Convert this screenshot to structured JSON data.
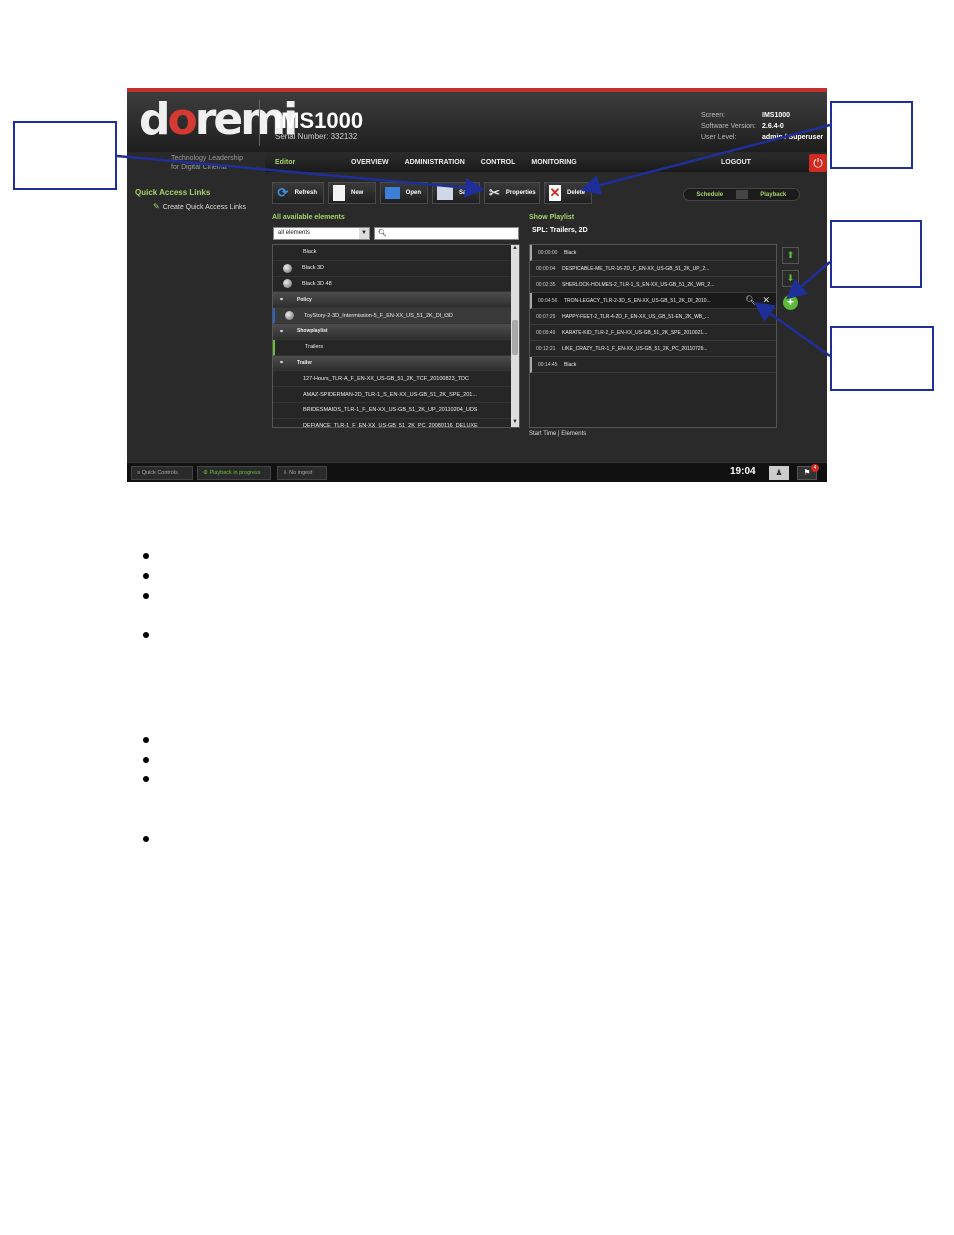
{
  "header": {
    "logo_text": "doremi",
    "tagline": "Technology Leadership for Digital Cinema",
    "product": "IMS1000",
    "serial": "Serial Number: 332132",
    "info": [
      {
        "key": "Screen:",
        "value": "IMS1000"
      },
      {
        "key": "Software Version:",
        "value": "2.6.4-0"
      },
      {
        "key": "User Level:",
        "value": "admin / Superuser"
      }
    ]
  },
  "nav": {
    "editor": "Editor",
    "overview": "OVERVIEW",
    "administration": "ADMINISTRATION",
    "control": "CONTROL",
    "monitoring": "MONITORING",
    "logout": "LOGOUT",
    "power_icon": "power-icon"
  },
  "sidebar": {
    "title": "Quick Access Links",
    "link": "Create Quick Access Links"
  },
  "toolbar": {
    "refresh": "Refresh",
    "new": "New",
    "open": "Open",
    "save": "Save",
    "properties": "Properties",
    "delete": "Delete"
  },
  "mode": {
    "schedule": "Schedule",
    "playback": "Playback"
  },
  "available": {
    "title": "All available elements",
    "filter": "all elements",
    "rows": [
      {
        "text": "Black",
        "kind": "plain"
      },
      {
        "text": "Black 3D",
        "kind": "item"
      },
      {
        "text": "Black 3D 48",
        "kind": "item"
      },
      {
        "text": "Policy",
        "kind": "group"
      },
      {
        "text": "ToyStory-2-3D_Intermission-5_F_EN-XX_US_51_2K_DI_t3D",
        "kind": "selected"
      },
      {
        "text": "Showplaylist",
        "kind": "group"
      },
      {
        "text": "Trailers",
        "kind": "green"
      },
      {
        "text": "Trailer",
        "kind": "group"
      },
      {
        "text": "127-Hours_TLR-A_F_EN-XX_US-GB_51_2K_TCF_20100823_TDC",
        "kind": "plain"
      },
      {
        "text": "AMAZ-SPIDERMAN-2D_TLR-1_S_EN-XX_US-GB_51_2K_SPE_201...",
        "kind": "plain"
      },
      {
        "text": "BRIDESMAIDS_TLR-1_F_EN-XX_US-GB_51_2K_UP_20110204_UDS",
        "kind": "plain"
      },
      {
        "text": "DEFIANCE_TLR-1_F_EN-XX_US-GB_51_2K_PC_20080116_DELUXE",
        "kind": "plain"
      }
    ]
  },
  "playlist": {
    "title": "Show Playlist",
    "spl_name": "SPL: Trailers, 2D",
    "rows": [
      {
        "time": "00:00:00",
        "name": "Black",
        "marked": true
      },
      {
        "time": "00:00:04",
        "name": "DESPICABLE-ME_TLR-16-2D_F_EN-XX_US-GB_51_2K_UP_2...",
        "marked": false
      },
      {
        "time": "00:02:35",
        "name": "SHERLOCK-HOLMES-2_TLR-1_S_EN-XX_US-GB_51_2K_WR_2...",
        "marked": false
      },
      {
        "time": "00:04:56",
        "name": "TRON-LEGACY_TLR-2-3D_S_EN-XX_US-GB_51_2K_DI_2010...",
        "marked": true,
        "highlight": true
      },
      {
        "time": "00:07:29",
        "name": "HAPPY-FEET-2_TLR-4-2D_F_EN-XX_US_GB_51-EN_2K_WB_...",
        "marked": false
      },
      {
        "time": "00:09:49",
        "name": "KARATE-KID_TLR-2_F_EN-XX_US-GB_51_2K_SPE_2010021...",
        "marked": false
      },
      {
        "time": "00:12:21",
        "name": "LIKE_CRAZY_TLR-1_F_EN-XX_US-GB_51_2K_PC_20110729...",
        "marked": false
      },
      {
        "time": "00:14:45",
        "name": "Black",
        "marked": true
      }
    ],
    "footer": "Start Time | Elements"
  },
  "statusbar": {
    "quick_controls": "Quick Controls",
    "playback": "Playback in progress",
    "ingest": "No ingest",
    "clock": "19:04",
    "flag_badge": "4"
  },
  "colors": {
    "accent_green": "#a7d36b",
    "brand_red": "#d43a32",
    "callout_blue": "#1f2f9a"
  }
}
